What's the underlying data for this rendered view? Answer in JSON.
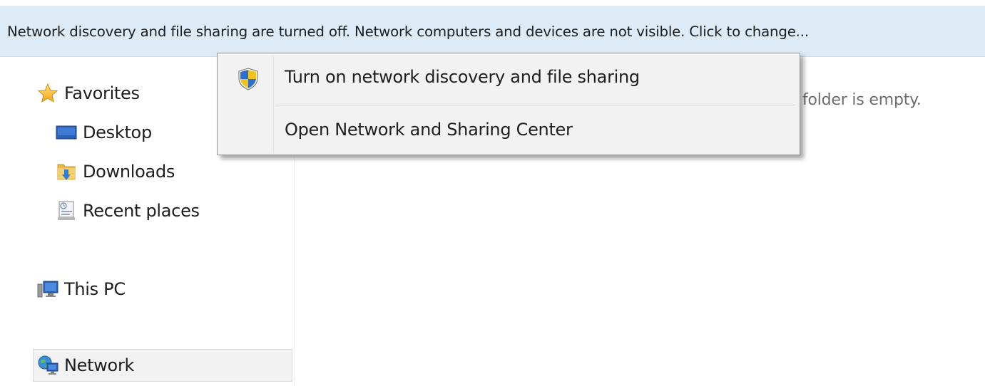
{
  "infobar": {
    "text": "Network discovery and file sharing are turned off. Network computers and devices are not visible. Click to change..."
  },
  "nav": {
    "items": [
      {
        "label": "Favorites",
        "icon": "star-icon",
        "group": "favorites"
      },
      {
        "label": "Desktop",
        "icon": "desktop-icon",
        "group": "favorites"
      },
      {
        "label": "Downloads",
        "icon": "downloads-folder-icon",
        "group": "favorites"
      },
      {
        "label": "Recent places",
        "icon": "recent-places-icon",
        "group": "favorites"
      },
      {
        "label": "This PC",
        "icon": "computer-icon",
        "group": "pc"
      },
      {
        "label": "Network",
        "icon": "network-icon",
        "group": "network",
        "selected": true
      }
    ]
  },
  "content": {
    "empty_text": "This folder is empty."
  },
  "menu": {
    "items": [
      {
        "label": "Turn on network discovery and file sharing",
        "icon": "uac-shield-icon"
      },
      {
        "label": "Open Network and Sharing Center",
        "icon": ""
      }
    ]
  },
  "colors": {
    "infobar_bg": "#dcebf5",
    "menu_bg": "#f2f2f2",
    "selected_bg": "#f2f2f2",
    "empty_text": "#6d6d6d"
  }
}
